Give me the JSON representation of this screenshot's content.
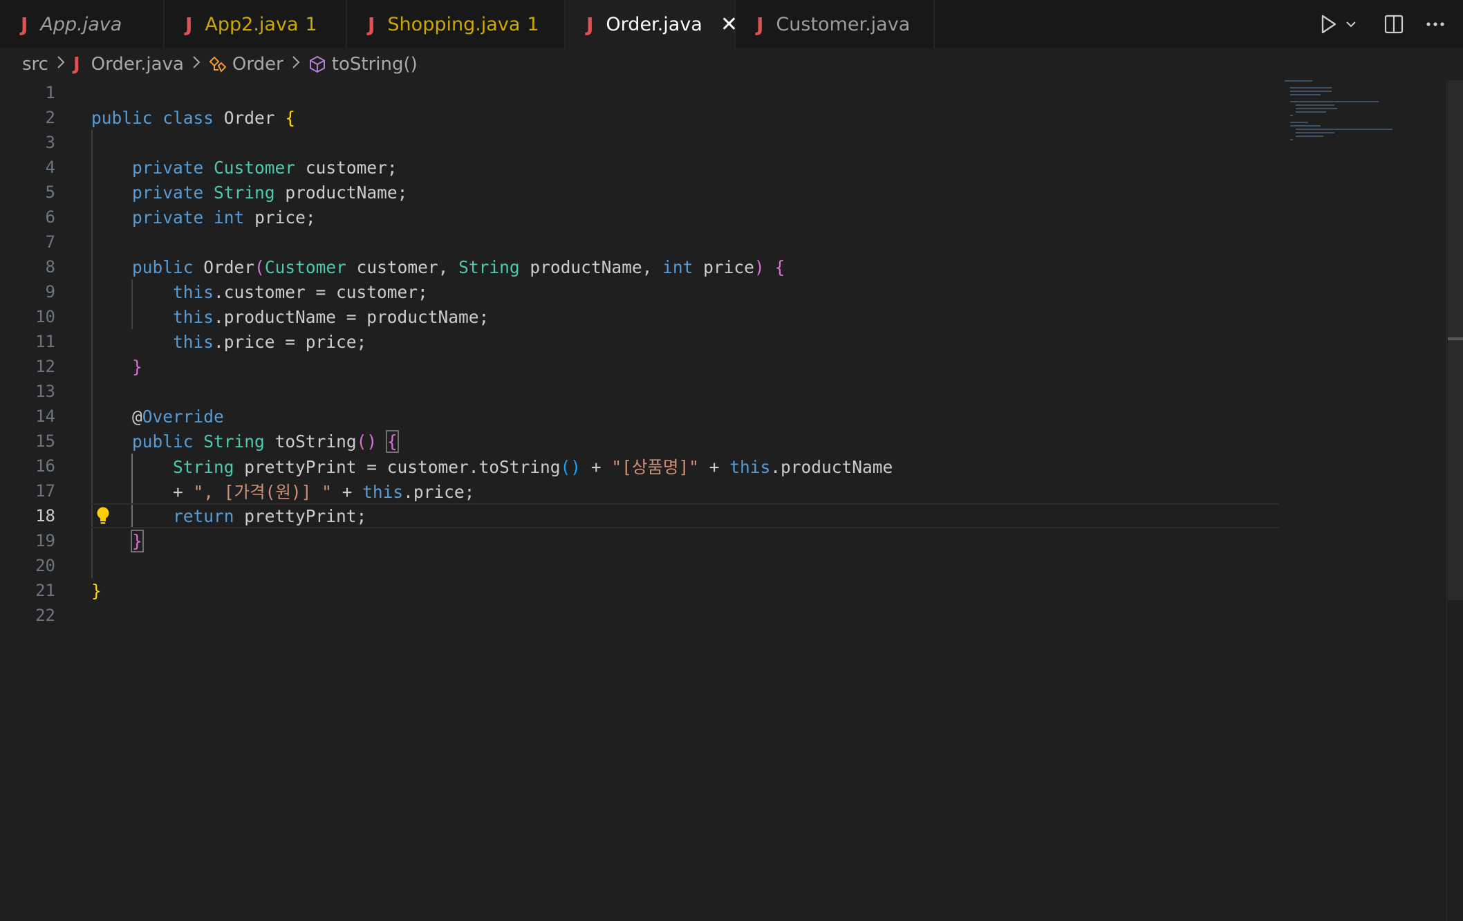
{
  "tabs": [
    {
      "label": "App.java",
      "count": "",
      "active": false,
      "style": "italic"
    },
    {
      "label": "App2.java",
      "count": "1",
      "active": false,
      "style": "warn"
    },
    {
      "label": "Shopping.java",
      "count": "1",
      "active": false,
      "style": "warn"
    },
    {
      "label": "Order.java",
      "count": "",
      "active": true,
      "style": "normal"
    },
    {
      "label": "Customer.java",
      "count": "",
      "active": false,
      "style": "normal"
    }
  ],
  "tab_icon": "J",
  "close_glyph": "✕",
  "breadcrumb": {
    "folder": "src",
    "file": "Order.java",
    "class": "Order",
    "method": "toString()"
  },
  "editor": {
    "current_line": 18,
    "line_numbers": [
      "1",
      "2",
      "3",
      "4",
      "5",
      "6",
      "7",
      "8",
      "9",
      "10",
      "11",
      "12",
      "13",
      "14",
      "15",
      "16",
      "17",
      "18",
      "19",
      "20",
      "21",
      "22"
    ]
  },
  "colors": {
    "keyword": "#569cd6",
    "type": "#4ec9b0",
    "string": "#ce9178",
    "bracket_1": "#ffd700",
    "bracket_2": "#da70d6",
    "bracket_3": "#179fff",
    "java_icon": "#e05252",
    "warning": "#cca700"
  },
  "icons": {
    "run": "run-icon",
    "run_dropdown": "chevron-down-icon",
    "split": "split-editor-icon",
    "more": "more-actions-icon",
    "bulb": "lightbulb-icon"
  }
}
